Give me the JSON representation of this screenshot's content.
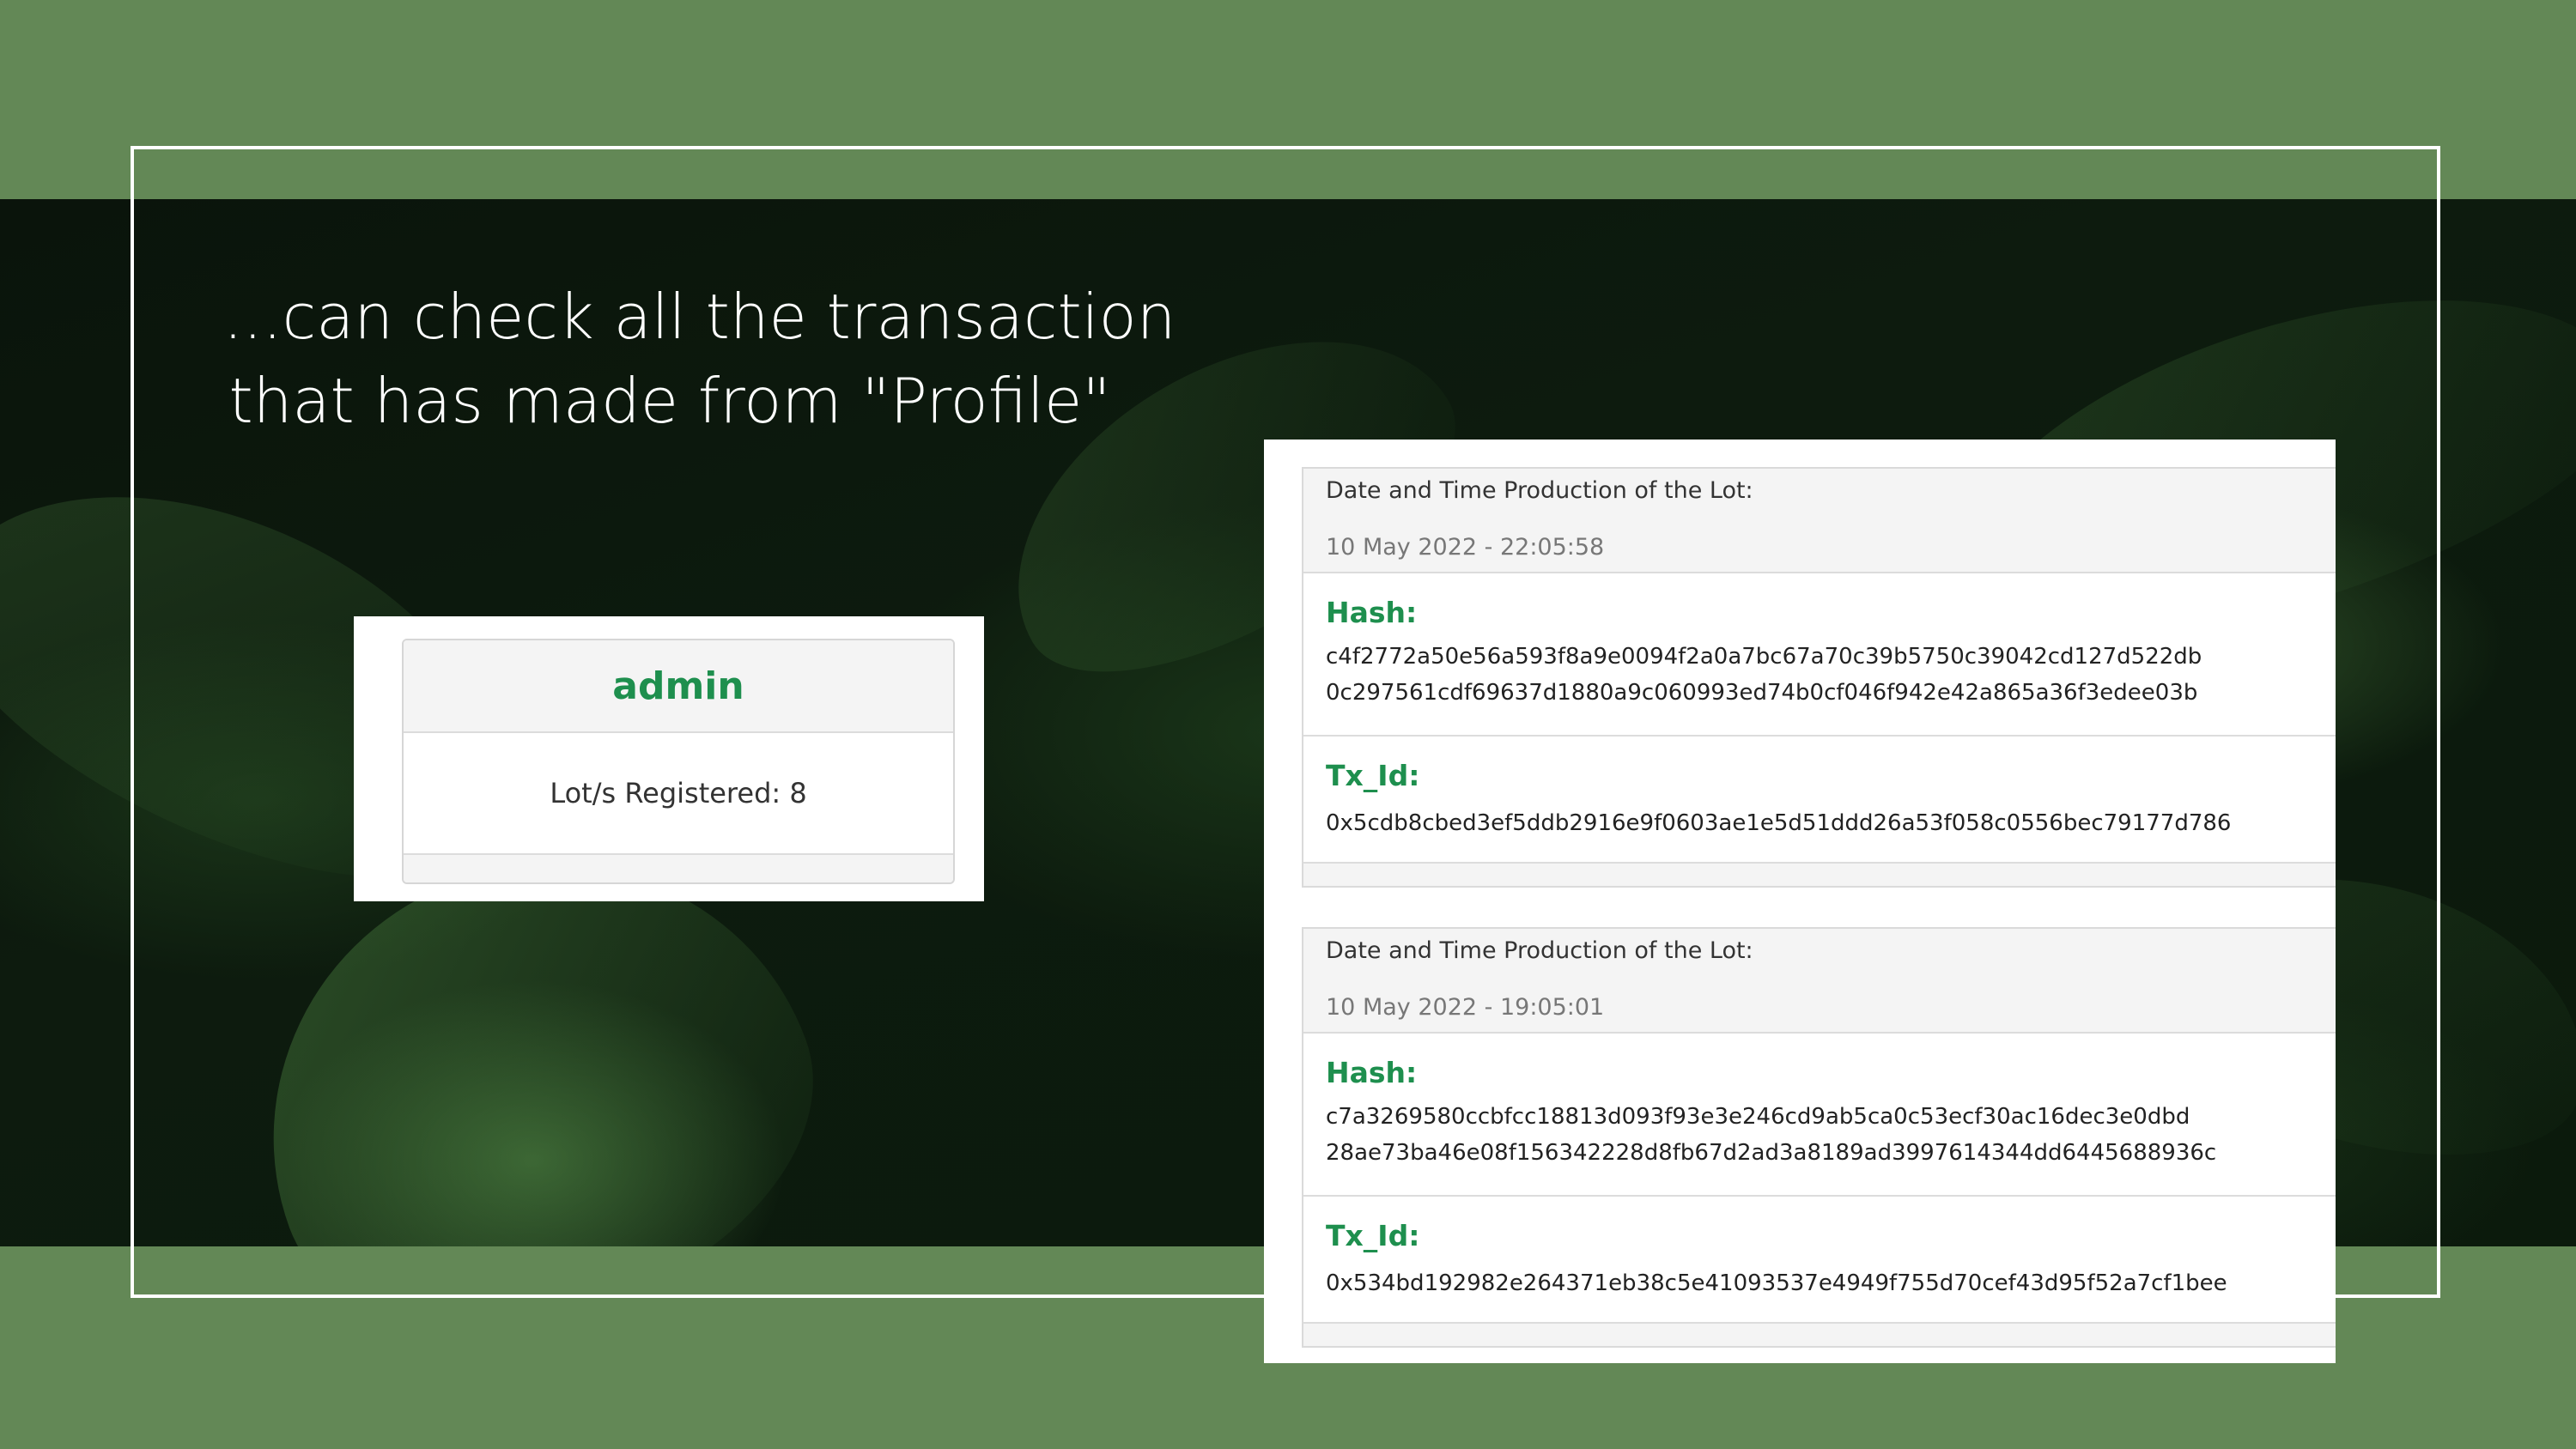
{
  "headline": {
    "line1": "...can check all the transaction",
    "line2": "that has made from \"Profile\""
  },
  "profile_card": {
    "username": "admin",
    "lots_registered": "Lot/s Registered: 8"
  },
  "transactions": [
    {
      "date_label": "Date and Time Production of the Lot:",
      "date_value": "10 May 2022 - 22:05:58",
      "hash_label": "Hash:",
      "hash_line1": "c4f2772a50e56a593f8a9e0094f2a0a7bc67a70c39b5750c39042cd127d522db",
      "hash_line2": "0c297561cdf69637d1880a9c060993ed74b0cf046f942e42a865a36f3edee03b",
      "txid_label": "Tx_Id:",
      "txid_value": "0x5cdb8cbed3ef5ddb2916e9f0603ae1e5d51ddd26a53f058c0556bec79177d786"
    },
    {
      "date_label": "Date and Time Production of the Lot:",
      "date_value": "10 May 2022 - 19:05:01",
      "hash_label": "Hash:",
      "hash_line1": "c7a3269580ccbfcc18813d093f93e3e246cd9ab5ca0c53ecf30ac16dec3e0dbd",
      "hash_line2": "28ae73ba46e08f156342228d8fb67d2ad3a8189ad3997614344dd6445688936c",
      "txid_label": "Tx_Id:",
      "txid_value": "0x534bd192982e264371eb38c5e41093537e4949f755d70cef43d95f52a7cf1bee"
    }
  ],
  "colors": {
    "band_green": "#638856",
    "accent_green": "#1e8f4e",
    "dark_background": "#0d1b0e"
  }
}
